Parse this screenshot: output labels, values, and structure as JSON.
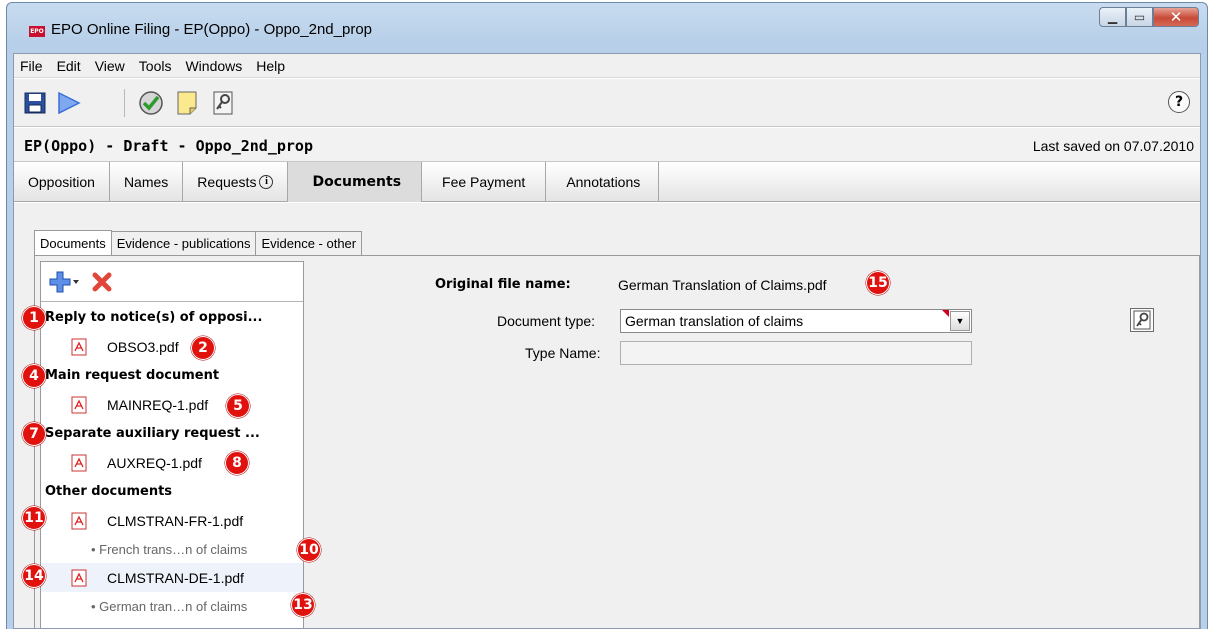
{
  "window": {
    "title": "EPO Online Filing - EP(Oppo) - Oppo_2nd_prop",
    "logo": "EPO"
  },
  "menu": [
    "File",
    "Edit",
    "View",
    "Tools",
    "Windows",
    "Help"
  ],
  "toolbar": {
    "icons": [
      "save-icon",
      "play-icon",
      "check-icon",
      "note-icon",
      "key-icon"
    ],
    "help_label": "?"
  },
  "infobar": {
    "title": "EP(Oppo) - Draft - Oppo_2nd_prop",
    "last_saved": "Last saved on 07.07.2010"
  },
  "main_tabs": [
    {
      "label": "Opposition"
    },
    {
      "label": "Names"
    },
    {
      "label": "Requests",
      "info": "i"
    },
    {
      "label": "Documents",
      "active": true
    },
    {
      "label": "Fee Payment"
    },
    {
      "label": "Annotations"
    }
  ],
  "sub_tabs": [
    "Documents",
    "Evidence - publications",
    "Evidence - other"
  ],
  "tree": {
    "groups": [
      {
        "header": "Reply to notice(s) of opposi...",
        "header_badge": "1",
        "files": [
          {
            "name": "OBSO3.pdf",
            "badge": "2"
          }
        ]
      },
      {
        "header": "Main request document",
        "header_badge": "4",
        "files": [
          {
            "name": "MAINREQ-1.pdf",
            "badge": "5"
          }
        ]
      },
      {
        "header": "Separate auxiliary request ...",
        "header_badge": "7",
        "files": [
          {
            "name": "AUXREQ-1.pdf",
            "badge": "8"
          }
        ]
      },
      {
        "header": "Other documents",
        "files": [
          {
            "name": "CLMSTRAN-FR-1.pdf",
            "badge": "11",
            "sub": "• French trans…n of claims",
            "sub_badge": "10"
          },
          {
            "name": "CLMSTRAN-DE-1.pdf",
            "badge": "14",
            "sub": "• German tran…n of claims",
            "sub_badge": "13",
            "selected": true
          }
        ]
      }
    ]
  },
  "detail": {
    "orig_label": "Original file name:",
    "orig_value": "German Translation of Claims.pdf",
    "orig_badge": "15",
    "doctype_label": "Document type:",
    "doctype_value": "German translation of claims",
    "typename_label": "Type Name:",
    "typename_value": ""
  },
  "colors": {
    "badge": "#e1110e",
    "accent": "#3a6fd8",
    "error": "#d0021b"
  }
}
